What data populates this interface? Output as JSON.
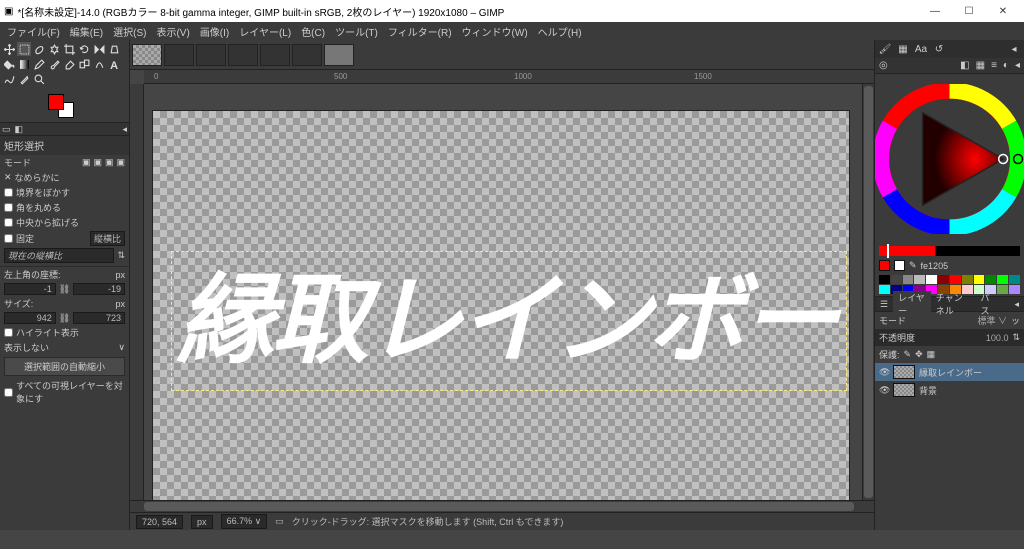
{
  "title": "*[名称未設定]-14.0 (RGBカラー 8-bit gamma integer, GIMP built-in sRGB, 2枚のレイヤー) 1920x1080 – GIMP",
  "menus": [
    "ファイル(F)",
    "編集(E)",
    "選択(S)",
    "表示(V)",
    "画像(I)",
    "レイヤー(L)",
    "色(C)",
    "ツール(T)",
    "フィルター(R)",
    "ウィンドウ(W)",
    "ヘルプ(H)"
  ],
  "toolopts": {
    "title": "矩形選択",
    "mode_label": "モード",
    "smooth": "なめらかに",
    "feather": "境界をぼかす",
    "rounded": "角を丸める",
    "expand": "中央から拡げる",
    "fixed": "固定",
    "fixed_mode": "縦横比",
    "ratio_label": "現在の縦横比",
    "pos_label": "左上角の座標:",
    "pos_unit": "px",
    "pos_x": "-1",
    "pos_y": "-19",
    "size_label": "サイズ:",
    "size_unit": "px",
    "size_w": "942",
    "size_h": "723",
    "highlight": "ハイライト表示",
    "noshow": "表示しない",
    "autoshrink": "選択範囲の自動縮小",
    "alllayers": "すべての可視レイヤーを対象にす"
  },
  "canvas_text": "縁取レインボー",
  "ruler_ticks": [
    "0",
    "500",
    "1000",
    "1500"
  ],
  "status": {
    "coords": "720, 564",
    "unit": "px",
    "zoom": "66.7% ∨",
    "msg": "クリック-ドラッグ: 選択マスクを移動します (Shift, Ctrl もできます)"
  },
  "right": {
    "hex_label": "fe1205",
    "palette": [
      "#000",
      "#444",
      "#888",
      "#bbb",
      "#fff",
      "#800",
      "#f00",
      "#808000",
      "#ff0",
      "#080",
      "#0f0",
      "#088",
      "#0ff",
      "#008",
      "#00f",
      "#808",
      "#f0f",
      "#840",
      "#f80",
      "#fcc",
      "#cfc",
      "#ccf",
      "#6a4",
      "#a8f"
    ],
    "layers_tab1": "レイヤー",
    "layers_tab2": "チャンネル",
    "layers_tab3": "パス",
    "mode_label": "モード",
    "mode_value": "標準 ∨",
    "opacity_label": "不透明度",
    "opacity_value": "100.0",
    "lock_label": "保護:",
    "layer1": "縁取レインボー",
    "layer2": "背景"
  }
}
